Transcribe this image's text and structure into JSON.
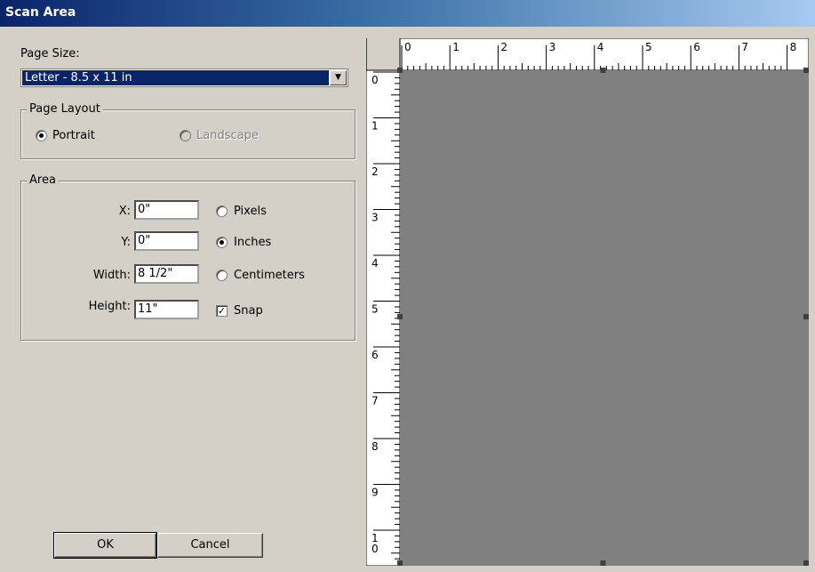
{
  "window": {
    "title": "Scan Area"
  },
  "page_size": {
    "label": "Page Size:",
    "value": "Letter - 8.5 x 11 in"
  },
  "page_layout": {
    "legend": "Page Layout",
    "portrait": {
      "label": "Portrait",
      "checked": true
    },
    "landscape": {
      "label": "Landscape",
      "checked": false,
      "disabled": true
    }
  },
  "area": {
    "legend": "Area",
    "x": {
      "label": "X:",
      "value": "0\""
    },
    "y": {
      "label": "Y:",
      "value": "0\""
    },
    "width": {
      "label": "Width:",
      "value": "8 1/2\""
    },
    "height": {
      "label": "Height:",
      "value": "11\""
    },
    "units": [
      {
        "label": "Pixels",
        "checked": false
      },
      {
        "label": "Inches",
        "checked": true
      },
      {
        "label": "Centimeters",
        "checked": false
      }
    ],
    "snap": {
      "label": "Snap",
      "checked": true
    }
  },
  "buttons": {
    "ok": "OK",
    "cancel": "Cancel"
  },
  "ruler": {
    "horizontal_labels": [
      "0",
      "1",
      "2",
      "3",
      "4",
      "5",
      "6",
      "7",
      "8"
    ],
    "vertical_labels": [
      "0",
      "1",
      "2",
      "3",
      "4",
      "5",
      "6",
      "7",
      "8",
      "9",
      "10"
    ]
  },
  "colors": {
    "preview_area": "#808080",
    "dialog_bg": "#d4d0c8",
    "title_start": "#0a246a"
  }
}
